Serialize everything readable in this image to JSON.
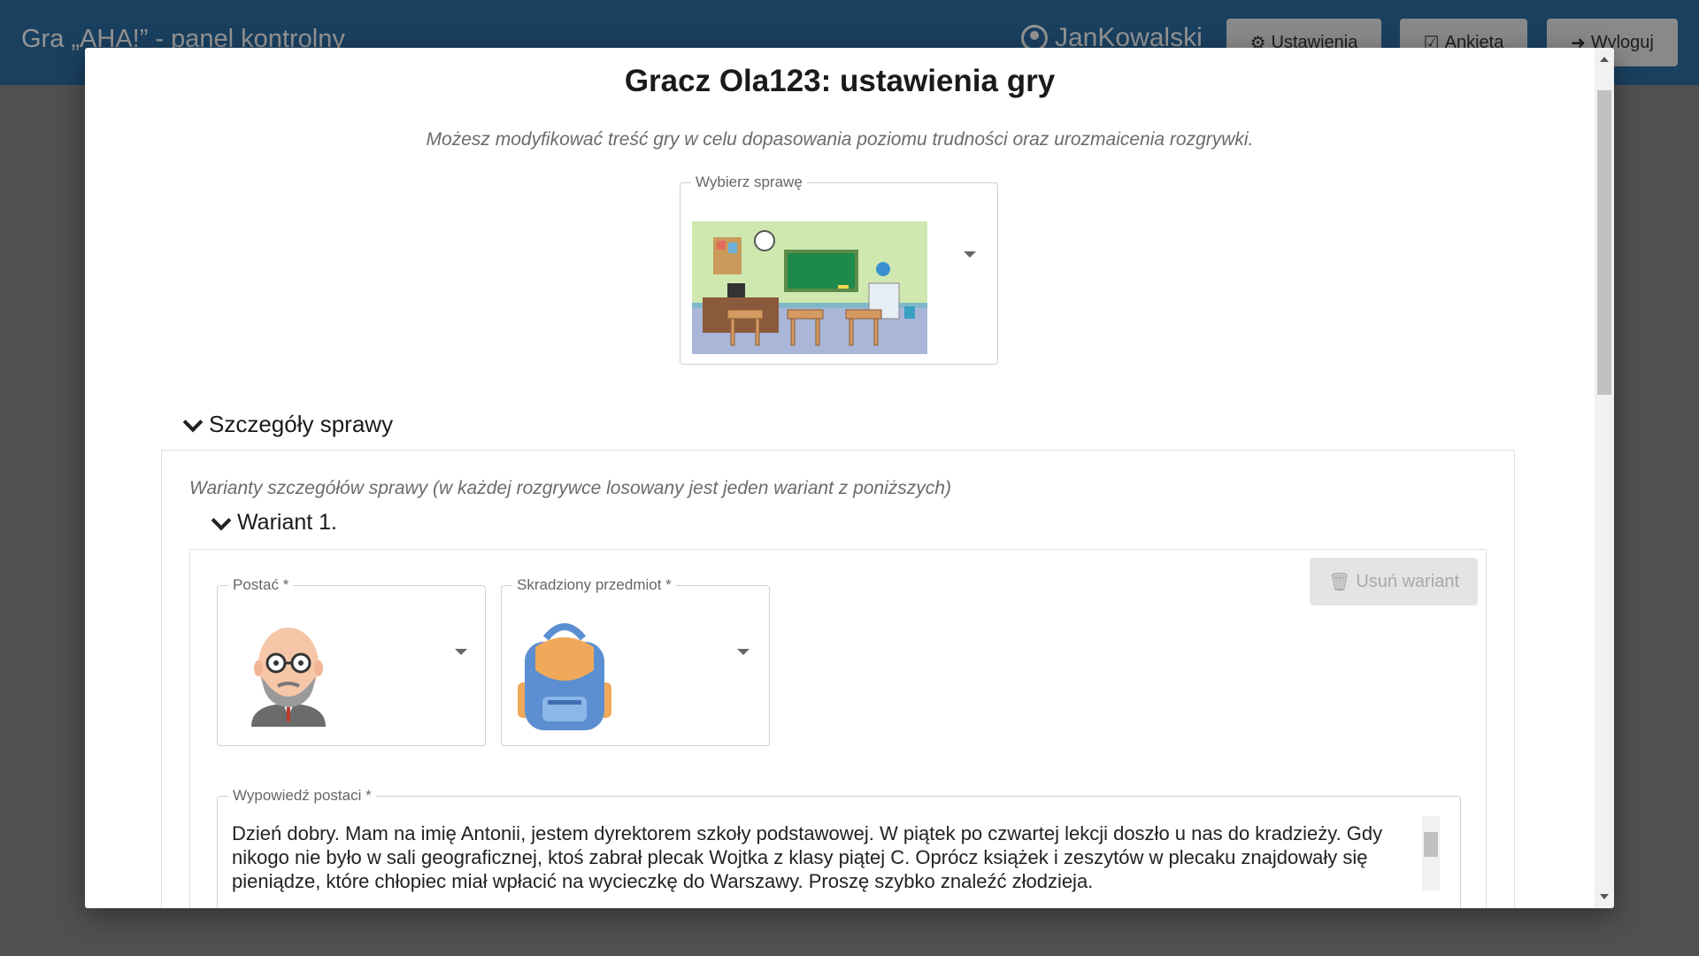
{
  "app": {
    "title": "Gra „AHA!” - panel kontrolny",
    "user": "JanKowalski",
    "buttons": {
      "settings": "Ustawienia",
      "survey": "Ankieta",
      "logout": "Wyloguj"
    }
  },
  "modal": {
    "title": "Gracz Ola123: ustawienia gry",
    "subtitle": "Możesz modyfikować treść gry w celu dopasowania poziomu trudności oraz urozmaicenia rozgrywki.",
    "case_select": {
      "label": "Wybierz sprawę",
      "value_icon": "classroom-image"
    },
    "case_details": {
      "heading": "Szczegóły sprawy",
      "note": "Warianty szczegółów sprawy (w każdej rozgrywce losowany jest jeden wariant z poniższych)",
      "variant": {
        "heading": "Wariant 1.",
        "delete_button": "Usuń wariant",
        "character": {
          "label": "Postać *",
          "value_icon": "bald-man-with-glasses-avatar"
        },
        "stolen_item": {
          "label": "Skradziony przedmiot *",
          "value_icon": "backpack-image"
        },
        "statement": {
          "label": "Wypowiedź postaci *",
          "value": "Dzień dobry. Mam na imię Antonii, jestem dyrektorem szkoły podstawowej. W piątek po czwartej lekcji doszło u nas do kradzieży. Gdy nikogo nie było w sali geograficznej, ktoś zabrał plecak Wojtka z klasy piątej C. Oprócz książek i zeszytów w plecaku znajdowały się pieniądze, które chłopiec miał wpłacić na wycieczkę do Warszawy. Proszę szybko znaleźć złodzieja."
        }
      }
    }
  }
}
